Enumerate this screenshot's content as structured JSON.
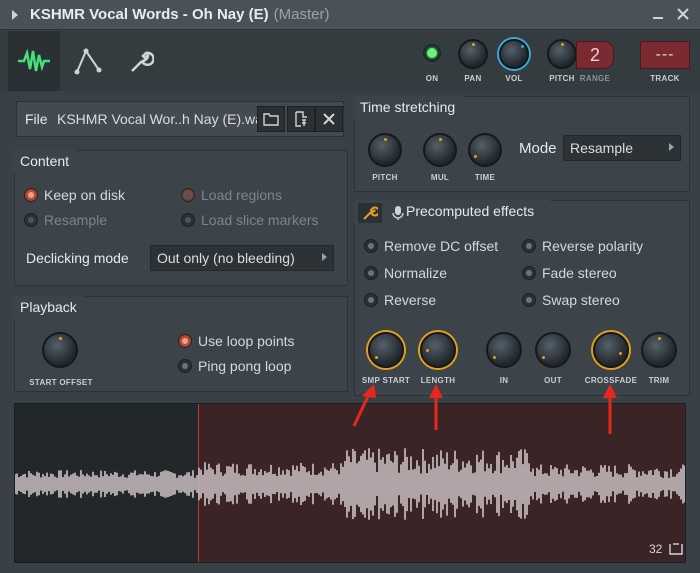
{
  "window": {
    "title": "KSHMR Vocal Words - Oh Nay (E)",
    "subtitle": "(Master)"
  },
  "toolbar": {
    "knobs": {
      "on": "ON",
      "pan": "PAN",
      "vol": "VOL",
      "pitch": "PITCH",
      "range": "RANGE",
      "track": "TRACK"
    },
    "range_value": "2",
    "track_value": "---"
  },
  "file": {
    "label": "File",
    "name": "KSHMR Vocal Wor..h Nay (E).wav"
  },
  "content": {
    "header": "Content",
    "keep_on_disk": "Keep on disk",
    "resample": "Resample",
    "load_regions": "Load regions",
    "load_slice_markers": "Load slice markers",
    "declicking_label": "Declicking mode",
    "declicking_value": "Out only (no bleeding)"
  },
  "playback": {
    "header": "Playback",
    "start_offset": "START OFFSET",
    "use_loop_points": "Use loop points",
    "ping_pong_loop": "Ping pong loop"
  },
  "time_stretching": {
    "header": "Time stretching",
    "pitch": "PITCH",
    "mul": "MUL",
    "time": "TIME",
    "mode_label": "Mode",
    "mode_value": "Resample"
  },
  "precomputed": {
    "header": "Precomputed effects",
    "remove_dc": "Remove DC offset",
    "normalize": "Normalize",
    "reverse": "Reverse",
    "reverse_polarity": "Reverse polarity",
    "fade_stereo": "Fade stereo",
    "swap_stereo": "Swap stereo",
    "knobs": {
      "smp_start": "SMP START",
      "length": "LENGTH",
      "in": "IN",
      "out": "OUT",
      "crossfade": "CROSSFADE",
      "trim": "TRIM"
    }
  },
  "waveform": {
    "zoom_value": "32"
  },
  "colors": {
    "accent_orange": "#e3a21a",
    "accent_blue": "#35a9e0",
    "accent_green": "#46e07a",
    "arrow_red": "#e8281c"
  }
}
